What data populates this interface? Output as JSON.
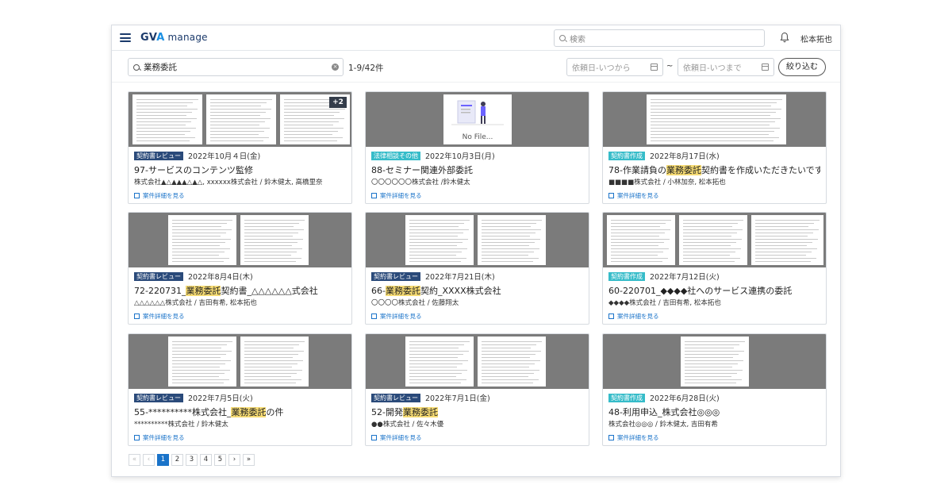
{
  "header": {
    "logo_prefix": "GV",
    "logo_accent": "A",
    "logo_suffix": "manage",
    "search_placeholder": "検索",
    "user_name": "松本拓也"
  },
  "filter": {
    "keyword": "業務委託",
    "result_count": "1-9/42件",
    "date_from_placeholder": "依頼日-いつから",
    "date_sep": "~",
    "date_to_placeholder": "依頼日-いつまで",
    "filter_button": "絞り込む"
  },
  "cards": [
    {
      "tag": "契約書レビュー",
      "tag_type": "review",
      "date": "2022年10月４日(金)",
      "title_before": "97-サービスのコンテンツ監修",
      "title_hl": "",
      "title_after": "",
      "party": "株式会社▲△▲▲▲△▲△, xxxxxx株式会社 / 鈴木健太, 高橋里奈",
      "link": "案件詳細を見る",
      "extra_pages": "+2"
    },
    {
      "tag": "法律相談その他",
      "tag_type": "legal",
      "date": "2022年10月3日(月)",
      "title_before": "88-セミナー関連外部委託",
      "title_hl": "",
      "title_after": "",
      "party": "〇〇〇〇〇〇株式会社 /鈴木健太",
      "link": "案件詳細を見る",
      "nofile": "No File..."
    },
    {
      "tag": "契約書作成",
      "tag_type": "create",
      "date": "2022年8月17日(水)",
      "title_before": "78-作業請負の",
      "title_hl": "業務委託",
      "title_after": "契約書を作成いただきたいです",
      "party": "■■■■株式会社 / 小林加奈, 松本拓也",
      "link": "案件詳細を見る"
    },
    {
      "tag": "契約書レビュー",
      "tag_type": "review",
      "date": "2022年8月4日(木)",
      "title_before": "72-220731_",
      "title_hl": "業務委託",
      "title_after": "契約書_△△△△△△式会社",
      "party": "△△△△△△株式会社 / 吉田有希, 松本拓也",
      "link": "案件詳細を見る"
    },
    {
      "tag": "契約書レビュー",
      "tag_type": "review",
      "date": "2022年7月21日(木)",
      "title_before": "66-",
      "title_hl": "業務委託",
      "title_after": "契約_XXXX株式会社",
      "party": "〇〇〇〇株式会社 / 佐藤翔太",
      "link": "案件詳細を見る"
    },
    {
      "tag": "契約書作成",
      "tag_type": "create",
      "date": "2022年7月12日(火)",
      "title_before": "60-220701_◆◆◆◆社へのサービス連携の委託",
      "title_hl": "",
      "title_after": "",
      "party": "◆◆◆◆株式会社 / 吉田有希, 松本拓也",
      "link": "案件詳細を見る"
    },
    {
      "tag": "契約書レビュー",
      "tag_type": "review",
      "date": "2022年7月5日(火)",
      "title_before": "55-**********株式会社_",
      "title_hl": "業務委託",
      "title_after": "の件",
      "party": "**********株式会社 / 鈴木健太",
      "link": "案件詳細を見る"
    },
    {
      "tag": "契約書レビュー",
      "tag_type": "review",
      "date": "2022年7月1日(金)",
      "title_before": "52-開発",
      "title_hl": "業務委託",
      "title_after": "",
      "party": "●●株式会社 / 佐々木優",
      "link": "案件詳細を見る"
    },
    {
      "tag": "契約書作成",
      "tag_type": "create",
      "date": "2022年6月28日(火)",
      "title_before": "48-利用申込_株式会社◎◎◎",
      "title_hl": "",
      "title_after": "",
      "party": "株式会社◎◎◎ / 鈴木健太, 吉田有希",
      "link": "案件詳細を見る"
    }
  ],
  "pagination": {
    "first": "«",
    "prev": "‹",
    "pages": [
      "1",
      "2",
      "3",
      "4",
      "5"
    ],
    "current": "1",
    "next": "›",
    "last": "»"
  },
  "colors": {
    "brand": "#1b3a6b",
    "accent": "#1a8fe3",
    "tag_review": "#2a4a7a",
    "tag_teal": "#36bcc9",
    "highlight": "#f7dc74",
    "link": "#1a73c9"
  }
}
